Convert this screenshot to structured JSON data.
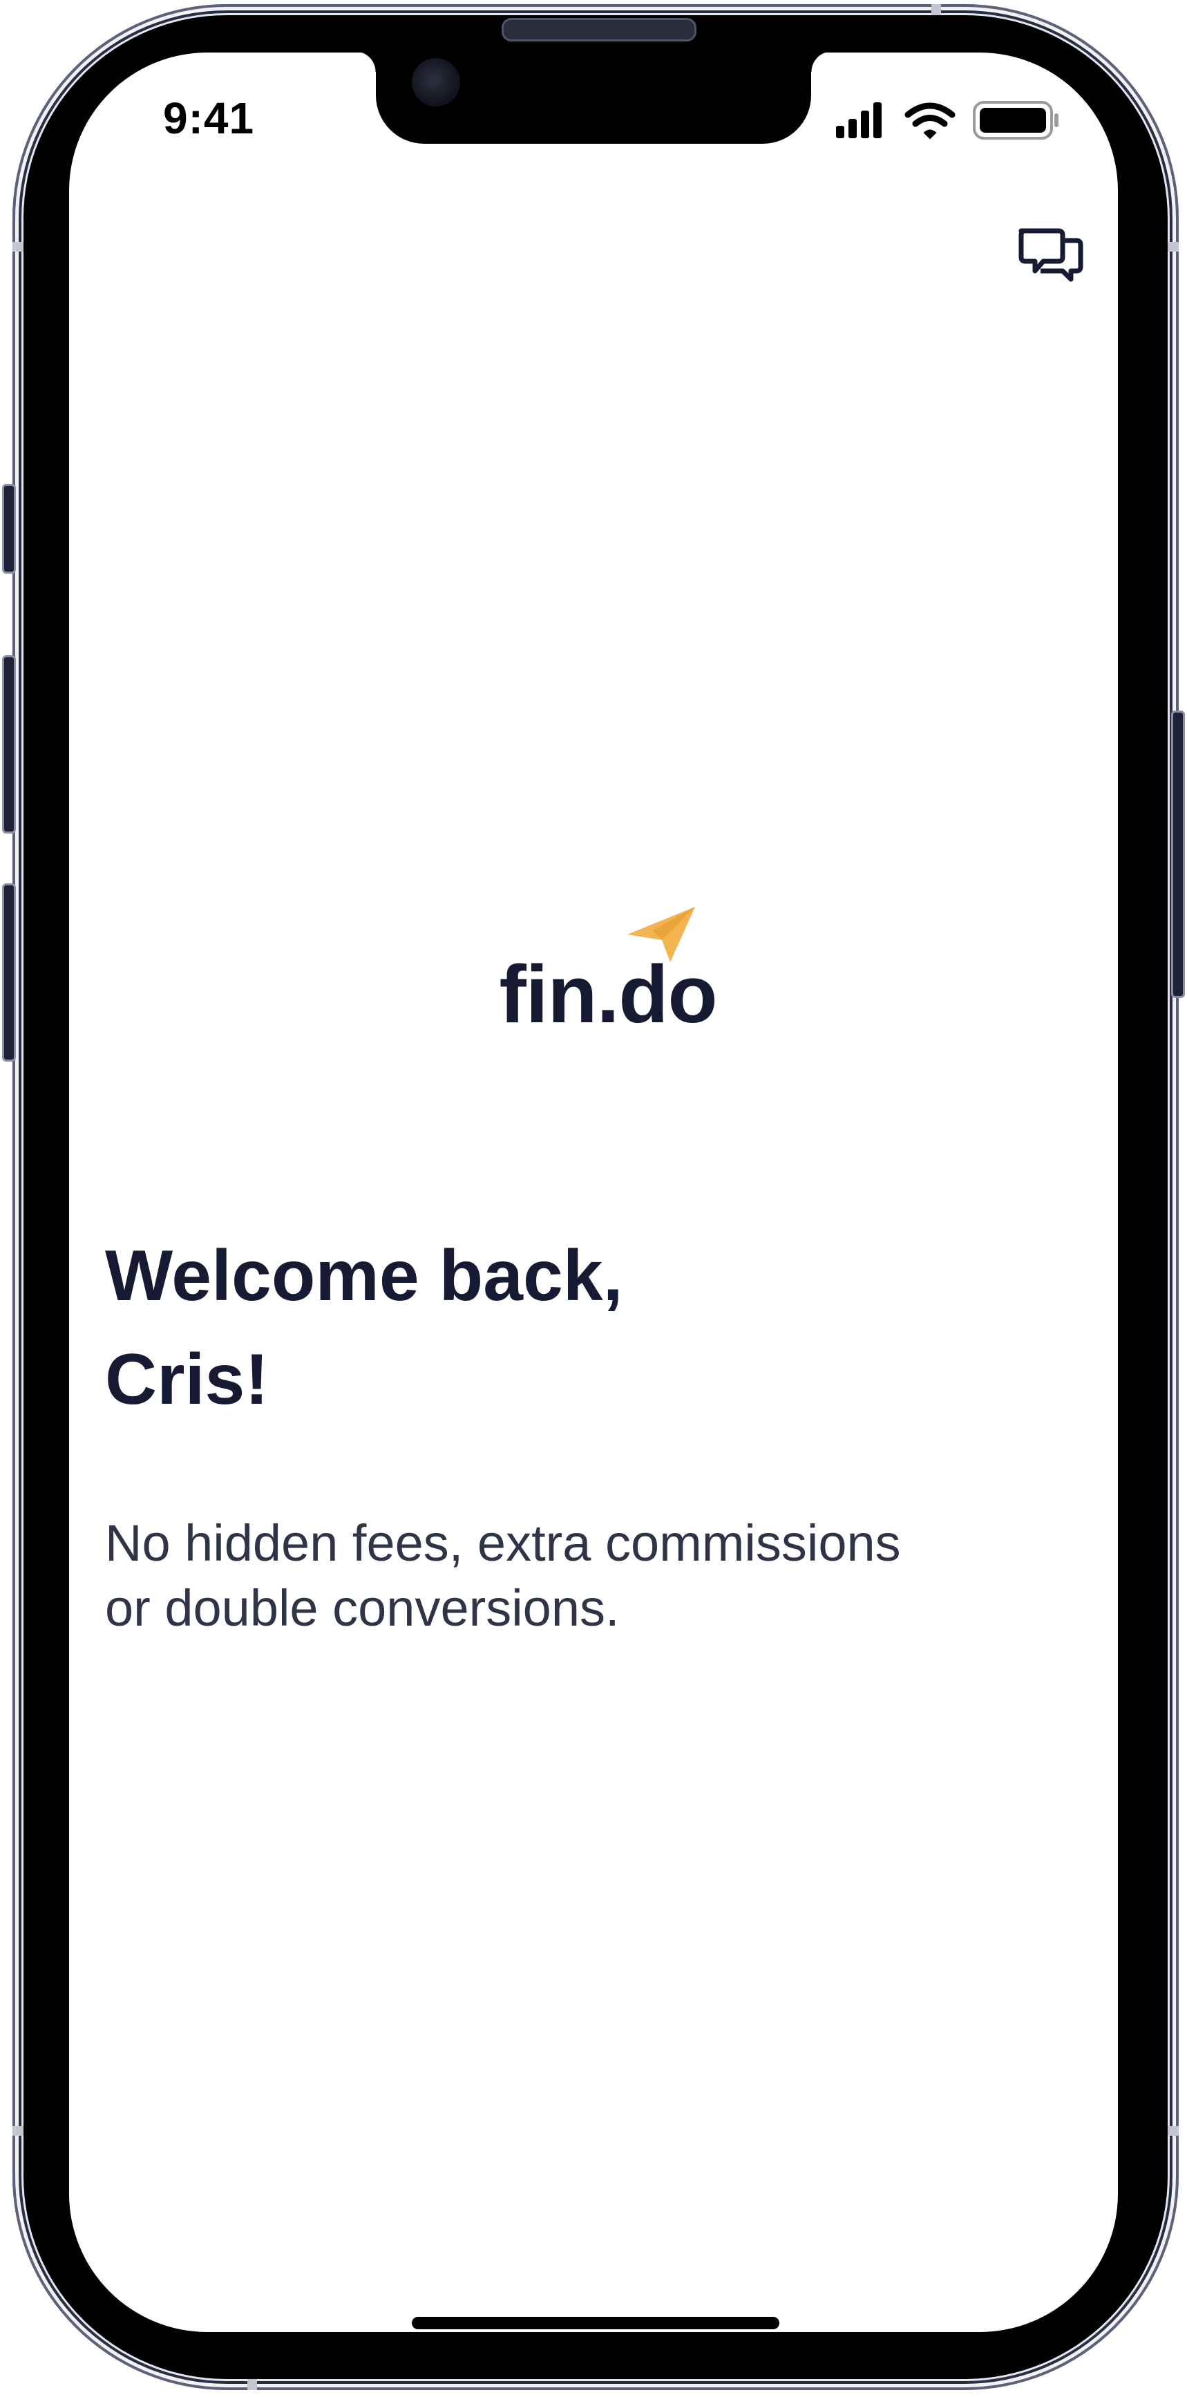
{
  "status_bar": {
    "time": "9:41",
    "icons": [
      "cellular-signal-icon",
      "wifi-icon",
      "battery-icon"
    ]
  },
  "header": {
    "chat_icon": "chat-bubbles-icon"
  },
  "logo": {
    "text": "fin.do",
    "mark_icon": "paper-plane-icon",
    "mark_color": "#F2B552"
  },
  "welcome": {
    "title_lines": [
      "Welcome back,",
      "Cris!"
    ],
    "subtitle_lines": [
      "No hidden fees, extra commissions",
      "or double conversions."
    ]
  },
  "colors": {
    "text_primary": "#161B33",
    "text_secondary": "#2F3446",
    "accent": "#F2B552",
    "background": "#FFFFFF"
  }
}
